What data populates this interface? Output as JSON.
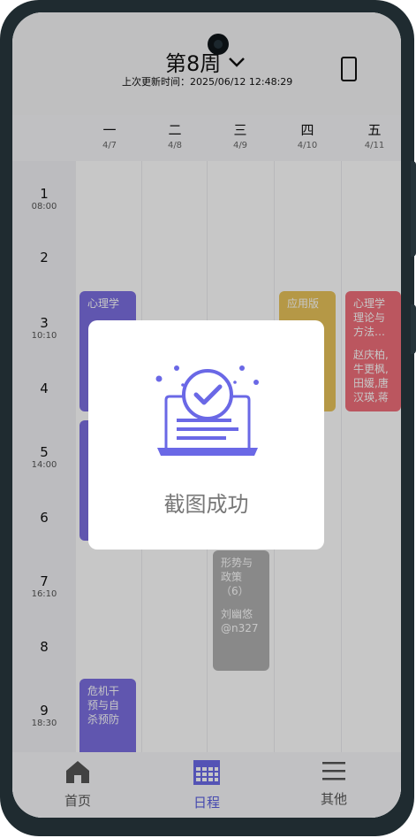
{
  "header": {
    "week_title": "第8周",
    "updated_text": "上次更新时间：2025/06/12 12:48:29"
  },
  "days": [
    {
      "name": "一",
      "date": "4/7"
    },
    {
      "name": "二",
      "date": "4/8"
    },
    {
      "name": "三",
      "date": "4/9"
    },
    {
      "name": "四",
      "date": "4/10"
    },
    {
      "name": "五",
      "date": "4/11"
    }
  ],
  "slots": [
    {
      "n": "1",
      "t": "08:00"
    },
    {
      "n": "2",
      "t": ""
    },
    {
      "n": "3",
      "t": "10:10"
    },
    {
      "n": "4",
      "t": ""
    },
    {
      "n": "5",
      "t": "14:00"
    },
    {
      "n": "6",
      "t": ""
    },
    {
      "n": "7",
      "t": "16:10"
    },
    {
      "n": "8",
      "t": ""
    },
    {
      "n": "9",
      "t": "18:30"
    }
  ],
  "courses": [
    {
      "title": "心理学",
      "detail": "",
      "color": "#7b6fe0"
    },
    {
      "title": "",
      "detail": "",
      "color": "#7b6fe0"
    },
    {
      "title": "应用版",
      "detail": "",
      "color": "#e8c35a"
    },
    {
      "title": "心理学理论与方法…",
      "detail": "赵庆柏,牛更枫,田媛,唐汉瑛,蒋",
      "color": "#f06f7a"
    },
    {
      "title": "形势与政策（6）",
      "detail": "刘幽悠@n327",
      "color": "#b0b0b0"
    },
    {
      "title": "危机干预与自杀预防",
      "detail": "",
      "color": "#7b6fe0"
    }
  ],
  "toast": {
    "message": "截图成功"
  },
  "nav": [
    {
      "label": "首页",
      "icon": "home-icon"
    },
    {
      "label": "日程",
      "icon": "calendar-icon"
    },
    {
      "label": "其他",
      "icon": "menu-icon"
    }
  ],
  "colors": {
    "accent": "#5a5fe0",
    "toast_icon": "#6a68e6"
  }
}
